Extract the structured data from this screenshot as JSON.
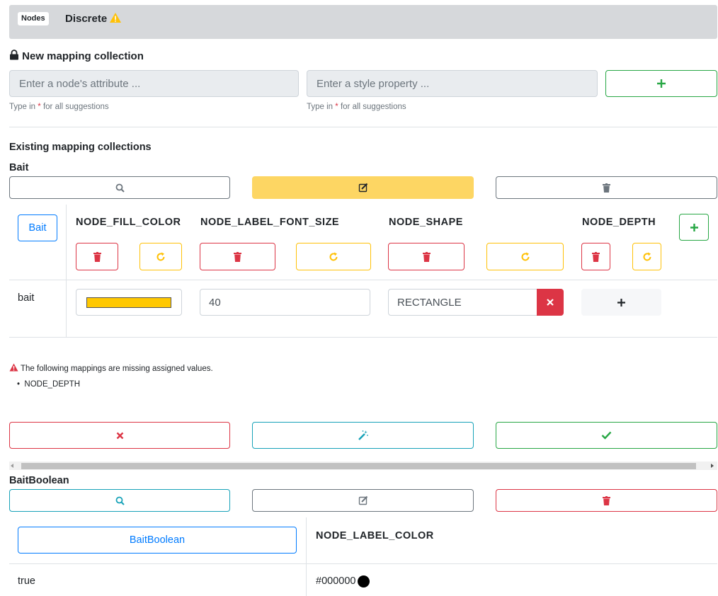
{
  "header": {
    "badge": "Nodes",
    "title": "Discrete"
  },
  "new_mapping": {
    "title": "New mapping collection",
    "attribute_placeholder": "Enter a node's attribute ...",
    "style_placeholder": "Enter a style property ...",
    "help_prefix": "Type in ",
    "help_star": "*",
    "help_suffix": " for all suggestions"
  },
  "existing": {
    "title": "Existing mapping collections",
    "collections": [
      {
        "name": "Bait",
        "attribute_button": "Bait",
        "columns": [
          "NODE_FILL_COLOR",
          "NODE_LABEL_FONT_SIZE",
          "NODE_SHAPE",
          "NODE_DEPTH"
        ],
        "row": {
          "key": "bait",
          "fill_color": "#ffc800",
          "font_size": "40",
          "shape": "RECTANGLE"
        },
        "warning": "The following mappings are missing assigned values.",
        "missing": [
          "NODE_DEPTH"
        ]
      },
      {
        "name": "BaitBoolean",
        "attribute_button": "BaitBoolean",
        "columns": [
          "NODE_LABEL_COLOR"
        ],
        "row": {
          "key": "true",
          "label_color": "#000000"
        }
      }
    ]
  },
  "colors": {
    "success": "#28a745",
    "danger": "#dc3545",
    "warning": "#ffc107",
    "info": "#17a2b8",
    "primary": "#007bff",
    "secondary": "#6c757d"
  }
}
